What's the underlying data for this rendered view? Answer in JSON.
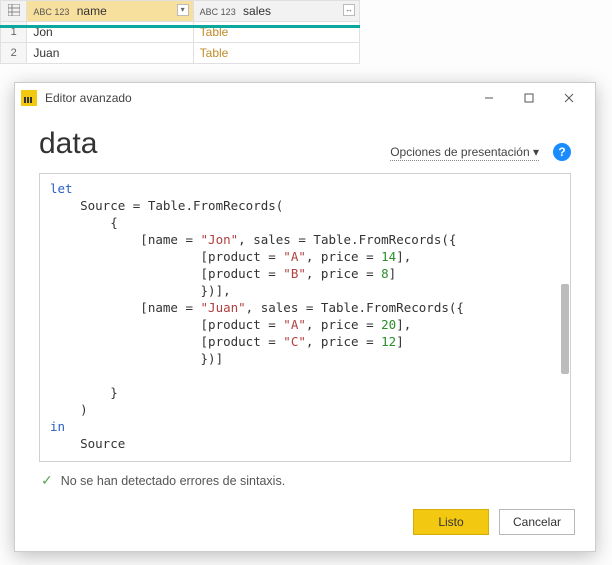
{
  "table": {
    "columns": [
      {
        "name": "name",
        "type_label": "ABC 123"
      },
      {
        "name": "sales",
        "type_label": "ABC 123"
      }
    ],
    "rows": [
      {
        "idx": "1",
        "name": "Jon",
        "sales": "Table"
      },
      {
        "idx": "2",
        "name": "Juan",
        "sales": "Table"
      }
    ]
  },
  "dialog": {
    "title": "Editor avanzado",
    "query_name": "data",
    "presentation_link": "Opciones de presentación",
    "help_label": "?",
    "status_text": "No se han detectado errores de sintaxis.",
    "buttons": {
      "ok": "Listo",
      "cancel": "Cancelar"
    },
    "code": {
      "l1_kw": "let",
      "l2_a": "    Source = Table.FromRecords(",
      "l3": "        {",
      "l4_a": "            [name = ",
      "l4_s1": "\"Jon\"",
      "l4_b": ", sales = Table.FromRecords({",
      "l5_a": "                    [product = ",
      "l5_s1": "\"A\"",
      "l5_b": ", price = ",
      "l5_n": "14",
      "l5_c": "],",
      "l6_a": "                    [product = ",
      "l6_s1": "\"B\"",
      "l6_b": ", price = ",
      "l6_n": "8",
      "l6_c": "]",
      "l7": "                    })],",
      "l8_a": "            [name = ",
      "l8_s1": "\"Juan\"",
      "l8_b": ", sales = Table.FromRecords({",
      "l9_a": "                    [product = ",
      "l9_s1": "\"A\"",
      "l9_b": ", price = ",
      "l9_n": "20",
      "l9_c": "],",
      "l10_a": "                    [product = ",
      "l10_s1": "\"C\"",
      "l10_b": ", price = ",
      "l10_n": "12",
      "l10_c": "]",
      "l11": "                    })]",
      "l13": "        }",
      "l14": "    )",
      "l15_kw": "in",
      "l16": "    Source"
    }
  }
}
